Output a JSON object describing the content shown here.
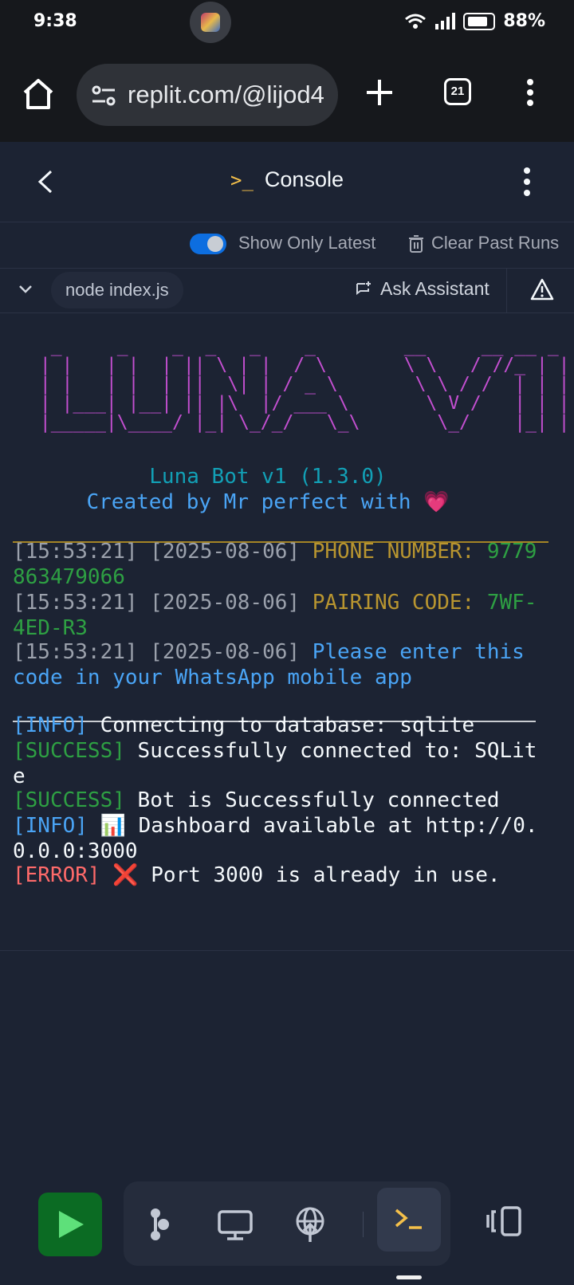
{
  "status": {
    "time": "9:38",
    "battery": "88%"
  },
  "browser": {
    "url": "replit.com/@lijod4",
    "tab_count": "21"
  },
  "header": {
    "title": "Console"
  },
  "options": {
    "show_latest": "Show Only Latest",
    "clear": "Clear Past Runs"
  },
  "run": {
    "command": "node index.js",
    "ask_assistant": "Ask Assistant"
  },
  "console": {
    "ascii_lines": [
      "  _     _    _  _   _    _        __     __ __ _ ",
      " | |   | |  | || \\ | |  / \\       \\ \\   / //_ | |",
      " | |   | |  | ||  \\| | / _ \\       \\ \\ / /  | | |",
      " | |___| |__| || |\\  |/ ___ \\       \\ V /   | | |",
      " |_____|\\____/ |_| \\_/_/   \\_\\       \\_/    |_| |"
    ],
    "bot_title": "Luna Bot v1 (1.3.0)",
    "bot_credit": "Created by Mr perfect with 💗",
    "logs": [
      {
        "ts": "[15:53:21] [2025-08-06] ",
        "label": "PHONE NUMBER: ",
        "value": "9779863479066"
      },
      {
        "ts": "[15:53:21] [2025-08-06] ",
        "label": "PAIRING CODE: ",
        "value": "7WF-4ED-R3"
      },
      {
        "ts": "[15:53:21] [2025-08-06] ",
        "message": "Please enter this code in your WhatsApp mobile app"
      }
    ],
    "status_lines": [
      {
        "tag": "[INFO]",
        "text": " Connecting to database: sqlite"
      },
      {
        "tag": "[SUCCESS]",
        "text": " Successfully connected to: SQLite"
      },
      {
        "tag": "[SUCCESS]",
        "text": " Bot is Successfully connected"
      },
      {
        "tag": "[INFO]",
        "text": " 📊 Dashboard available at http://0.0.0.0:3000"
      },
      {
        "tag": "[ERROR]",
        "text": " ❌ Port 3000 is already in use."
      }
    ]
  },
  "colors": {
    "accent_run": "#0b6b23",
    "ascii": "#c34fd0",
    "info": "#4aa4f5",
    "success": "#2ea043",
    "error": "#ff6a6a"
  }
}
